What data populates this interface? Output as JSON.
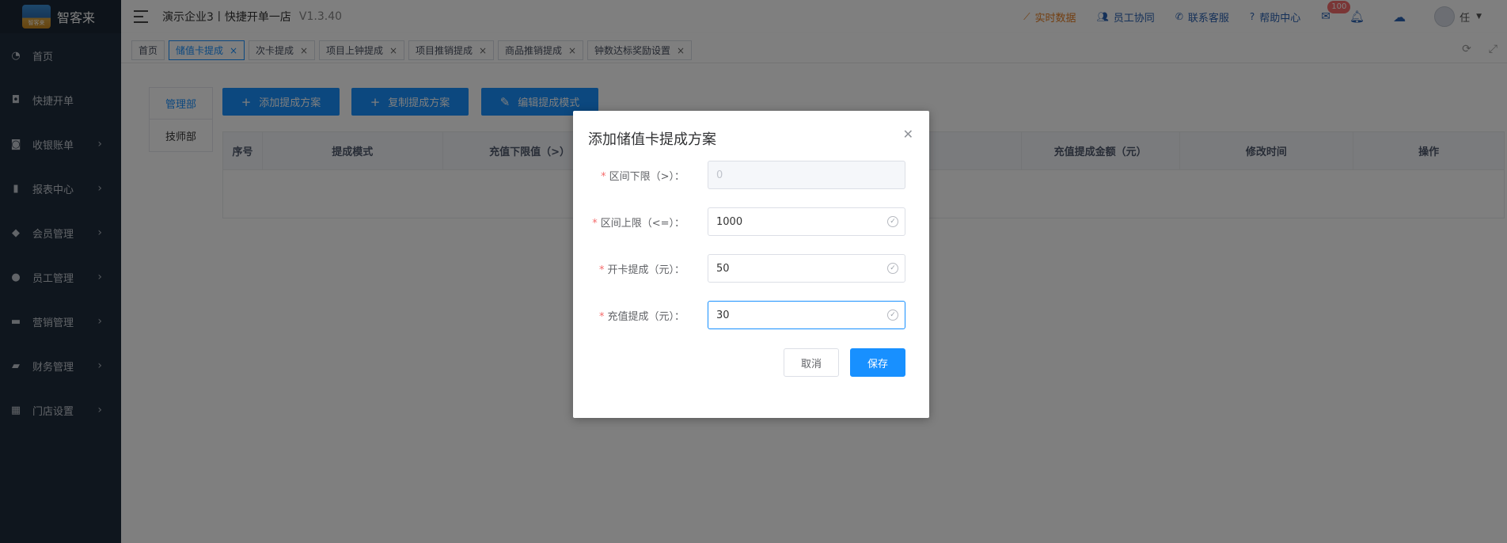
{
  "app": {
    "logo_text": "智客来",
    "logo_sub": "智客来",
    "store_title": "演示企业3丨快捷开单一店",
    "version": "V1.3.40"
  },
  "sidebar": {
    "items": [
      {
        "label": "首页",
        "icon": "dashboard-icon",
        "has_arrow": false
      },
      {
        "label": "快捷开单",
        "icon": "bag-icon",
        "has_arrow": false
      },
      {
        "label": "收银账单",
        "icon": "money-bag-icon",
        "has_arrow": true
      },
      {
        "label": "报表中心",
        "icon": "bar-chart-icon",
        "has_arrow": true
      },
      {
        "label": "会员管理",
        "icon": "diamond-icon",
        "has_arrow": true
      },
      {
        "label": "员工管理",
        "icon": "user-icon",
        "has_arrow": true
      },
      {
        "label": "营销管理",
        "icon": "briefcase-icon",
        "has_arrow": true
      },
      {
        "label": "财务管理",
        "icon": "wallet-icon",
        "has_arrow": true
      },
      {
        "label": "门店设置",
        "icon": "grid-icon",
        "has_arrow": true
      }
    ]
  },
  "header": {
    "links": [
      {
        "label": "实时数据",
        "icon": "trend-icon"
      },
      {
        "label": "员工协同",
        "icon": "users-icon"
      },
      {
        "label": "联系客服",
        "icon": "phone-icon"
      },
      {
        "label": "帮助中心",
        "icon": "help-icon"
      }
    ],
    "mail_badge": "100",
    "user_name": "任"
  },
  "tags": [
    {
      "label": "首页",
      "closable": false,
      "active": false
    },
    {
      "label": "储值卡提成",
      "closable": true,
      "active": true
    },
    {
      "label": "次卡提成",
      "closable": true,
      "active": false
    },
    {
      "label": "项目上钟提成",
      "closable": true,
      "active": false
    },
    {
      "label": "项目推销提成",
      "closable": true,
      "active": false
    },
    {
      "label": "商品推销提成",
      "closable": true,
      "active": false
    },
    {
      "label": "钟数达标奖励设置",
      "closable": true,
      "active": false
    }
  ],
  "main": {
    "dept_tabs": [
      "管理部",
      "技师部"
    ],
    "buttons": {
      "add": "添加提成方案",
      "copy": "复制提成方案",
      "edit": "编辑提成模式"
    },
    "table_headers": [
      "序号",
      "提成模式",
      "充值下限值（>）",
      "",
      "充值提成金额（元）",
      "修改时间",
      "操作"
    ]
  },
  "dialog": {
    "title": "添加储值卡提成方案",
    "fields": [
      {
        "label": "区间下限（>）：",
        "value": "0",
        "disabled": true
      },
      {
        "label": "区间上限（<=）：",
        "value": "1000",
        "disabled": false
      },
      {
        "label": "开卡提成（元）：",
        "value": "50",
        "disabled": false
      },
      {
        "label": "充值提成（元）：",
        "value": "30",
        "disabled": false
      }
    ],
    "cancel_label": "取消",
    "save_label": "保存"
  },
  "colors": {
    "primary": "#1890ff",
    "sidebar_bg": "#1f2d3d",
    "badge": "#f56c6c",
    "realtime_link": "#e67e22"
  }
}
